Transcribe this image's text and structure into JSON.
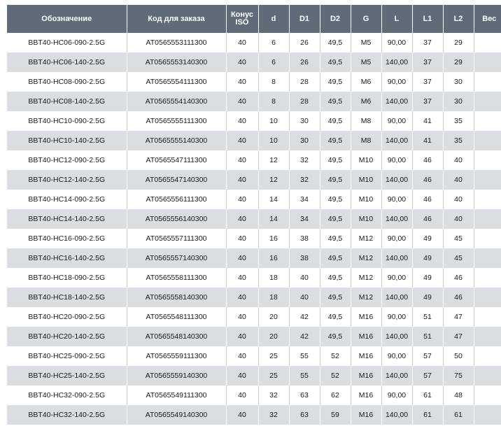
{
  "header": {
    "designation": "Обозначение",
    "order_code": "Код для заказа",
    "cone_line1": "Конус",
    "cone_line2": "ISO",
    "d": "d",
    "D1": "D1",
    "D2": "D2",
    "G": "G",
    "L": "L",
    "L1": "L1",
    "L2": "L2",
    "weight": "Вес"
  },
  "rows": [
    [
      "BBT40-HC06-090-2.5G",
      "AT0565553111300",
      "40",
      "6",
      "26",
      "49,5",
      "M5",
      "90,00",
      "37",
      "29",
      ""
    ],
    [
      "BBT40-HC06-140-2.5G",
      "AT0565553140300",
      "40",
      "6",
      "26",
      "49,5",
      "M5",
      "140,00",
      "37",
      "29",
      ""
    ],
    [
      "BBT40-HC08-090-2.5G",
      "AT0565554111300",
      "40",
      "8",
      "28",
      "49,5",
      "M6",
      "90,00",
      "37",
      "30",
      ""
    ],
    [
      "BBT40-HC08-140-2.5G",
      "AT0565554140300",
      "40",
      "8",
      "28",
      "49,5",
      "M6",
      "140,00",
      "37",
      "30",
      ""
    ],
    [
      "BBT40-HC10-090-2.5G",
      "AT0565555111300",
      "40",
      "10",
      "30",
      "49,5",
      "M8",
      "90,00",
      "41",
      "35",
      ""
    ],
    [
      "BBT40-HC10-140-2.5G",
      "AT0565555140300",
      "40",
      "10",
      "30",
      "49,5",
      "M8",
      "140,00",
      "41",
      "35",
      ""
    ],
    [
      "BBT40-HC12-090-2.5G",
      "AT0565547111300",
      "40",
      "12",
      "32",
      "49,5",
      "M10",
      "90,00",
      "46",
      "40",
      ""
    ],
    [
      "BBT40-HC12-140-2.5G",
      "AT0565547140300",
      "40",
      "12",
      "32",
      "49,5",
      "M10",
      "140,00",
      "46",
      "40",
      ""
    ],
    [
      "BBT40-HC14-090-2.5G",
      "AT0565556111300",
      "40",
      "14",
      "34",
      "49,5",
      "M10",
      "90,00",
      "46",
      "40",
      ""
    ],
    [
      "BBT40-HC14-140-2.5G",
      "AT0565556140300",
      "40",
      "14",
      "34",
      "49,5",
      "M10",
      "140,00",
      "46",
      "40",
      ""
    ],
    [
      "BBT40-HC16-090-2.5G",
      "AT0565557111300",
      "40",
      "16",
      "38",
      "49,5",
      "M12",
      "90,00",
      "49",
      "45",
      ""
    ],
    [
      "BBT40-HC16-140-2.5G",
      "AT0565557140300",
      "40",
      "16",
      "38",
      "49,5",
      "M12",
      "140,00",
      "49",
      "45",
      ""
    ],
    [
      "BBT40-HC18-090-2.5G",
      "AT0565558111300",
      "40",
      "18",
      "40",
      "49,5",
      "M12",
      "90,00",
      "49",
      "46",
      ""
    ],
    [
      "BBT40-HC18-140-2.5G",
      "AT0565558140300",
      "40",
      "18",
      "40",
      "49,5",
      "M12",
      "140,00",
      "49",
      "46",
      ""
    ],
    [
      "BBT40-HC20-090-2.5G",
      "AT0565548111300",
      "40",
      "20",
      "42",
      "49,5",
      "M16",
      "90,00",
      "51",
      "47",
      ""
    ],
    [
      "BBT40-HC20-140-2.5G",
      "AT0565548140300",
      "40",
      "20",
      "42",
      "49,5",
      "M16",
      "140,00",
      "51",
      "47",
      ""
    ],
    [
      "BBT40-HC25-090-2.5G",
      "AT0565559111300",
      "40",
      "25",
      "55",
      "52",
      "M16",
      "90,00",
      "57",
      "50",
      ""
    ],
    [
      "BBT40-HC25-140-2.5G",
      "AT0565559140300",
      "40",
      "25",
      "55",
      "52",
      "M16",
      "140,00",
      "57",
      "75",
      ""
    ],
    [
      "BBT40-HC32-090-2.5G",
      "AT0565549111300",
      "40",
      "32",
      "63",
      "62",
      "M16",
      "90,00",
      "61",
      "48",
      ""
    ],
    [
      "BBT40-HC32-140-2.5G",
      "AT0565549140300",
      "40",
      "32",
      "63",
      "59",
      "M16",
      "140,00",
      "61",
      "61",
      ""
    ]
  ],
  "colors": {
    "header_bg": "#5f6b78",
    "header_text": "#ffffff",
    "row_even_bg": "#ffffff",
    "row_odd_bg": "#dadde1"
  }
}
